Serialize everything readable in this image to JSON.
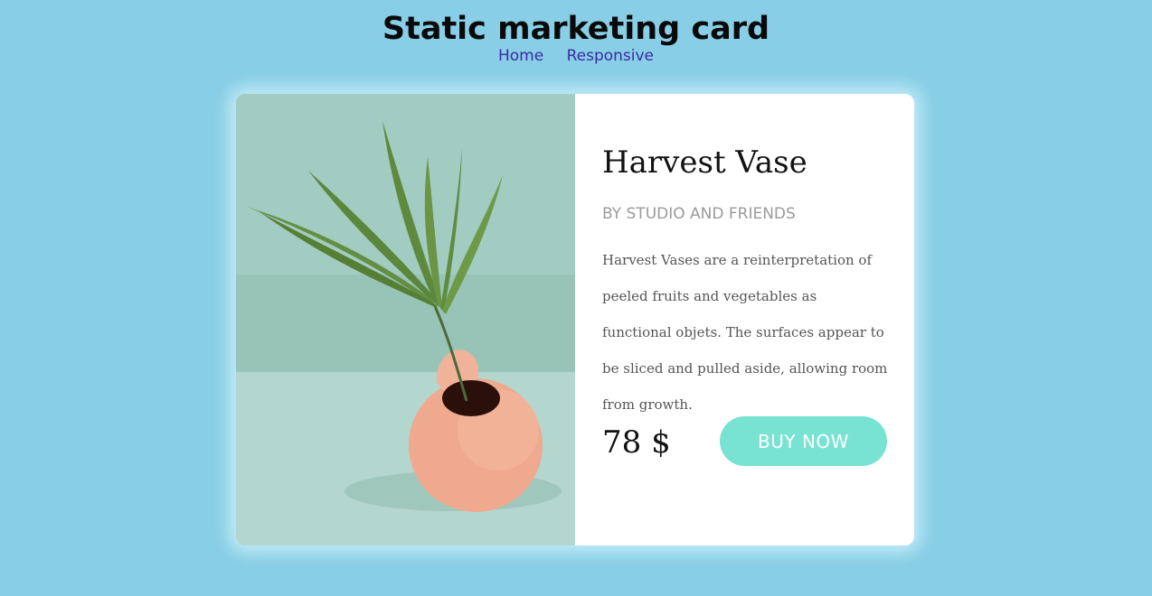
{
  "header": {
    "title": "Static marketing card",
    "nav": [
      {
        "label": "Home"
      },
      {
        "label": "Responsive"
      }
    ]
  },
  "card": {
    "product_name": "Harvest Vase",
    "brand": "BY STUDIO AND FRIENDS",
    "description": "Harvest Vases are a reinterpretation of peeled fruits and vegetables as functional objets. The surfaces appear to be sliced and pulled aside, allowing room from growth.",
    "price": "78 $",
    "buy_label": "BUY NOW"
  },
  "colors": {
    "background": "#88cee6",
    "accent": "#78e3d2",
    "nav_link": "#3b2aa6"
  }
}
